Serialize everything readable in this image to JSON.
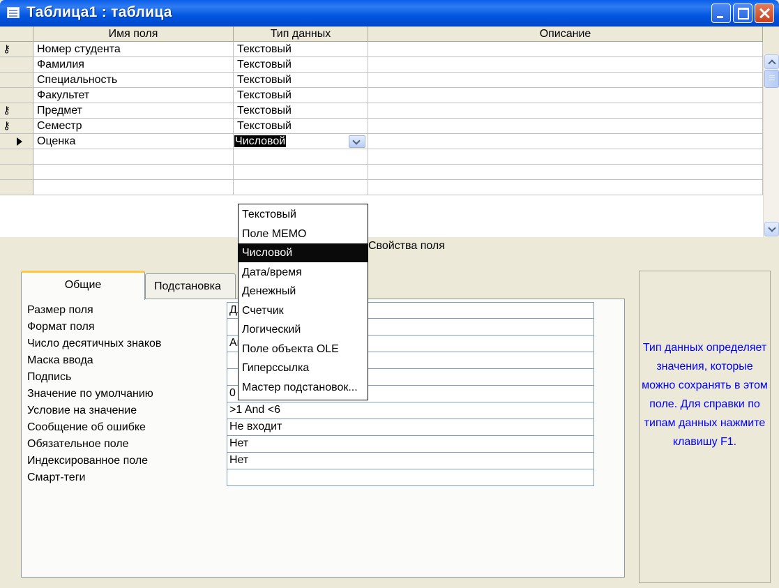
{
  "window": {
    "title": "Таблица1 : таблица",
    "buttons": {
      "minimize": "minimize-icon",
      "maximize": "maximize-icon",
      "close": "close-icon"
    }
  },
  "grid": {
    "headers": {
      "name": "Имя поля",
      "type": "Тип данных",
      "description": "Описание"
    },
    "rows": [
      {
        "key": true,
        "name": "Номер студента",
        "type": "Текстовый",
        "description": ""
      },
      {
        "key": false,
        "name": "Фамилия",
        "type": "Текстовый",
        "description": ""
      },
      {
        "key": false,
        "name": "Специальность",
        "type": "Текстовый",
        "description": ""
      },
      {
        "key": false,
        "name": "Факультет",
        "type": "Текстовый",
        "description": ""
      },
      {
        "key": true,
        "name": "Предмет",
        "type": "Текстовый",
        "description": ""
      },
      {
        "key": true,
        "name": "Семестр",
        "type": "Текстовый",
        "description": ""
      },
      {
        "key": false,
        "current": true,
        "name": "Оценка",
        "type": "Числовой",
        "description": ""
      }
    ],
    "key_glyph": "⚷"
  },
  "type_dropdown": {
    "selected": "Числовой",
    "options": [
      "Текстовый",
      "Поле MEMO",
      "Числовой",
      "Дата/время",
      "Денежный",
      "Счетчик",
      "Логический",
      "Поле объекта OLE",
      "Гиперссылка",
      "Мастер подстановок..."
    ]
  },
  "field_properties": {
    "label": "Свойства поля",
    "tabs": {
      "general": "Общие",
      "lookup": "Подстановка"
    },
    "rows": [
      {
        "label": "Размер поля",
        "value": "Длинное целое"
      },
      {
        "label": "Формат поля",
        "value": ""
      },
      {
        "label": "Число десятичных знаков",
        "value": "Авто"
      },
      {
        "label": "Маска ввода",
        "value": ""
      },
      {
        "label": "Подпись",
        "value": ""
      },
      {
        "label": "Значение по умолчанию",
        "value": "0"
      },
      {
        "label": "Условие на значение",
        "value": ">1 And <6"
      },
      {
        "label": "Сообщение об ошибке",
        "value": "Не входит"
      },
      {
        "label": "Обязательное поле",
        "value": "Нет"
      },
      {
        "label": "Индексированное поле",
        "value": "Нет"
      },
      {
        "label": "Смарт-теги",
        "value": ""
      }
    ]
  },
  "help": {
    "text": "Тип данных определяет значения, которые можно сохранять в этом поле. Для справки по типам данных нажмите клавишу F1.",
    "color": "#0000FF"
  },
  "colors": {
    "title_bar": "#0056E0",
    "tab_highlight": "#FFC83C",
    "selection": "#000000"
  }
}
